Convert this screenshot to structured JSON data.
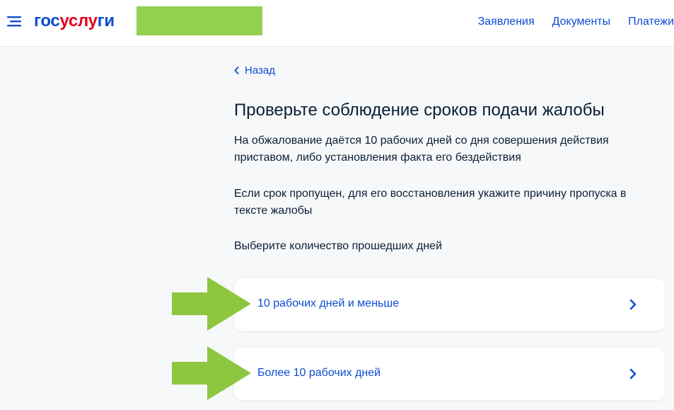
{
  "header": {
    "logo": {
      "part1": "гос",
      "part2": "услу",
      "part3": "ги"
    },
    "nav": [
      "Заявления",
      "Документы",
      "Платежи"
    ]
  },
  "back_label": "Назад",
  "title": "Проверьте соблюдение сроков подачи жалобы",
  "paragraphs": [
    "На обжалование даётся 10 рабочих дней со дня совершения действия приставом, либо установления факта его бездействия",
    "Если срок пропущен, для его восстановления укажите причину пропуска в тексте жалобы",
    "Выберите количество прошедших дней"
  ],
  "options": [
    {
      "label": "10 рабочих дней и меньше"
    },
    {
      "label": "Более 10 рабочих дней"
    }
  ],
  "colors": {
    "brand_blue": "#0d4cd3",
    "brand_red": "#e3001b",
    "annotation_green": "#8dc63f",
    "redaction_green": "#92d050"
  }
}
